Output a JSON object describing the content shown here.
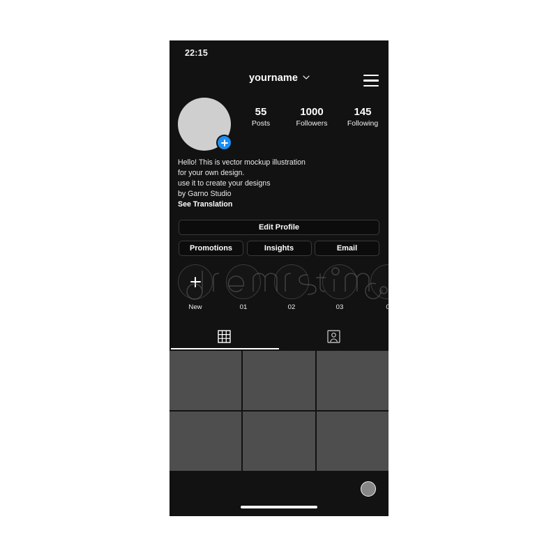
{
  "status_bar": {
    "time": "22:15"
  },
  "top_nav": {
    "username": "yourname",
    "chevron_icon": "chevron-down-icon",
    "menu_icon": "hamburger-menu-icon"
  },
  "profile": {
    "avatar_icon": "avatar-placeholder",
    "add_badge_icon": "plus-icon",
    "stats": [
      {
        "value": "55",
        "label": "Posts"
      },
      {
        "value": "1000",
        "label": "Followers"
      },
      {
        "value": "145",
        "label": "Following"
      }
    ],
    "bio_lines": [
      "Hello! This is vector mockup illustration",
      "for your own design.",
      "use it to create your designs",
      "by Garno Studio"
    ],
    "see_translation": "See Translation"
  },
  "actions": {
    "edit_profile": "Edit Profile",
    "promotions": "Promotions",
    "insights": "Insights",
    "email": "Email"
  },
  "highlights": [
    {
      "label": "New",
      "icon": "plus-icon"
    },
    {
      "label": "01",
      "icon": ""
    },
    {
      "label": "02",
      "icon": ""
    },
    {
      "label": "03",
      "icon": ""
    },
    {
      "label": "0",
      "icon": ""
    }
  ],
  "tabs": [
    {
      "name": "grid",
      "icon": "grid-icon",
      "active": true
    },
    {
      "name": "tagged",
      "icon": "tagged-person-icon",
      "active": false
    }
  ],
  "photo_grid": {
    "tiles": [
      "",
      "",
      "",
      "",
      "",
      ""
    ]
  },
  "bottom_bar": {
    "profile_button_icon": "profile-avatar-icon",
    "home_indicator_icon": "home-indicator"
  },
  "watermark": {
    "text": "dreamstime",
    "mark": "®"
  },
  "colors": {
    "background": "#121212",
    "accent_blue": "#1e8ff0",
    "avatar_gray": "#d0cfcf",
    "tile_gray": "#4e4e4e",
    "text_primary": "#ffffff",
    "border_gray": "#3a3a3a"
  }
}
